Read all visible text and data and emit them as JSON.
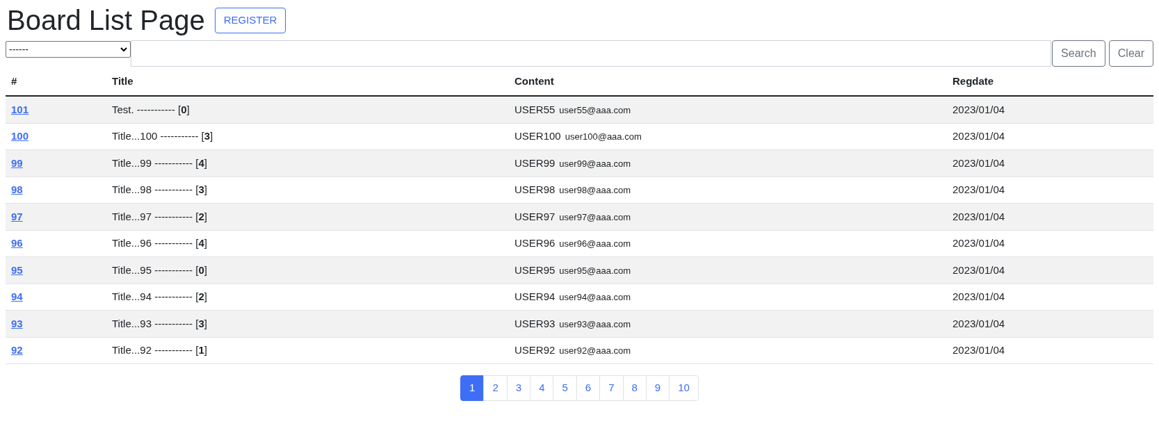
{
  "page_title": "Board List Page",
  "register_button": "REGISTER",
  "search": {
    "type_select": "------",
    "search_button": "Search",
    "clear_button": "Clear"
  },
  "table": {
    "columns": [
      "#",
      "Title",
      "Content",
      "Regdate"
    ],
    "rows": [
      {
        "bno": "101",
        "title": "Test. ----------- [**0**]",
        "writer": "USER55",
        "email": "user55@aaa.com",
        "regdate": "2023/01/04"
      },
      {
        "bno": "100",
        "title": "Title...100 ----------- [**3**]",
        "writer": "USER100",
        "email": "user100@aaa.com",
        "regdate": "2023/01/04"
      },
      {
        "bno": "99",
        "title": "Title...99 ----------- [**4**]",
        "writer": "USER99",
        "email": "user99@aaa.com",
        "regdate": "2023/01/04"
      },
      {
        "bno": "98",
        "title": "Title...98 ----------- [**3**]",
        "writer": "USER98",
        "email": "user98@aaa.com",
        "regdate": "2023/01/04"
      },
      {
        "bno": "97",
        "title": "Title...97 ----------- [**2**]",
        "writer": "USER97",
        "email": "user97@aaa.com",
        "regdate": "2023/01/04"
      },
      {
        "bno": "96",
        "title": "Title...96 ----------- [**4**]",
        "writer": "USER96",
        "email": "user96@aaa.com",
        "regdate": "2023/01/04"
      },
      {
        "bno": "95",
        "title": "Title...95 ----------- [**0**]",
        "writer": "USER95",
        "email": "user95@aaa.com",
        "regdate": "2023/01/04"
      },
      {
        "bno": "94",
        "title": "Title...94 ----------- [**2**]",
        "writer": "USER94",
        "email": "user94@aaa.com",
        "regdate": "2023/01/04"
      },
      {
        "bno": "93",
        "title": "Title...93 ----------- [**3**]",
        "writer": "USER93",
        "email": "user93@aaa.com",
        "regdate": "2023/01/04"
      },
      {
        "bno": "92",
        "title": "Title...92 ----------- [**1**]",
        "writer": "USER92",
        "email": "user92@aaa.com",
        "regdate": "2023/01/04"
      }
    ]
  },
  "pagination": [
    {
      "label": "1",
      "selected": true
    },
    {
      "label": "2",
      "selected": false
    },
    {
      "label": "3",
      "selected": false
    },
    {
      "label": "4",
      "selected": false
    },
    {
      "label": "5",
      "selected": false
    },
    {
      "label": "6",
      "selected": false
    },
    {
      "label": "7",
      "selected": false
    },
    {
      "label": "8",
      "selected": false
    },
    {
      "label": "9",
      "selected": false
    },
    {
      "label": "10",
      "selected": false
    }
  ]
}
